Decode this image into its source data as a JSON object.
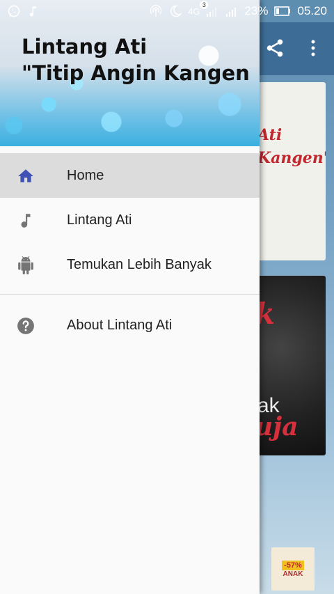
{
  "status_bar": {
    "battery_percent": "23%",
    "time": "05.20",
    "network": "4G",
    "notification_count": "3"
  },
  "drawer": {
    "header_title": "Lintang Ati\n\"Titip Angin Kangen",
    "items": [
      {
        "label": "Home",
        "icon": "home-icon",
        "active": true
      },
      {
        "label": "Lintang Ati",
        "icon": "music-note-icon",
        "active": false
      },
      {
        "label": "Temukan Lebih Banyak",
        "icon": "android-icon",
        "active": false
      }
    ],
    "secondary_items": [
      {
        "label": "About Lintang Ati",
        "icon": "help-icon"
      }
    ]
  },
  "background": {
    "card1_text": "Ati\nKangen\"",
    "card2_text_top": "k",
    "card2_text_mid": "ak",
    "card2_text_bottom": "uja",
    "ad_badge": "-57%",
    "ad_brand": "ANAK"
  },
  "colors": {
    "accent": "#3f51b5",
    "active_row": "#dcdcdc",
    "toolbar": "#3d6d97"
  }
}
